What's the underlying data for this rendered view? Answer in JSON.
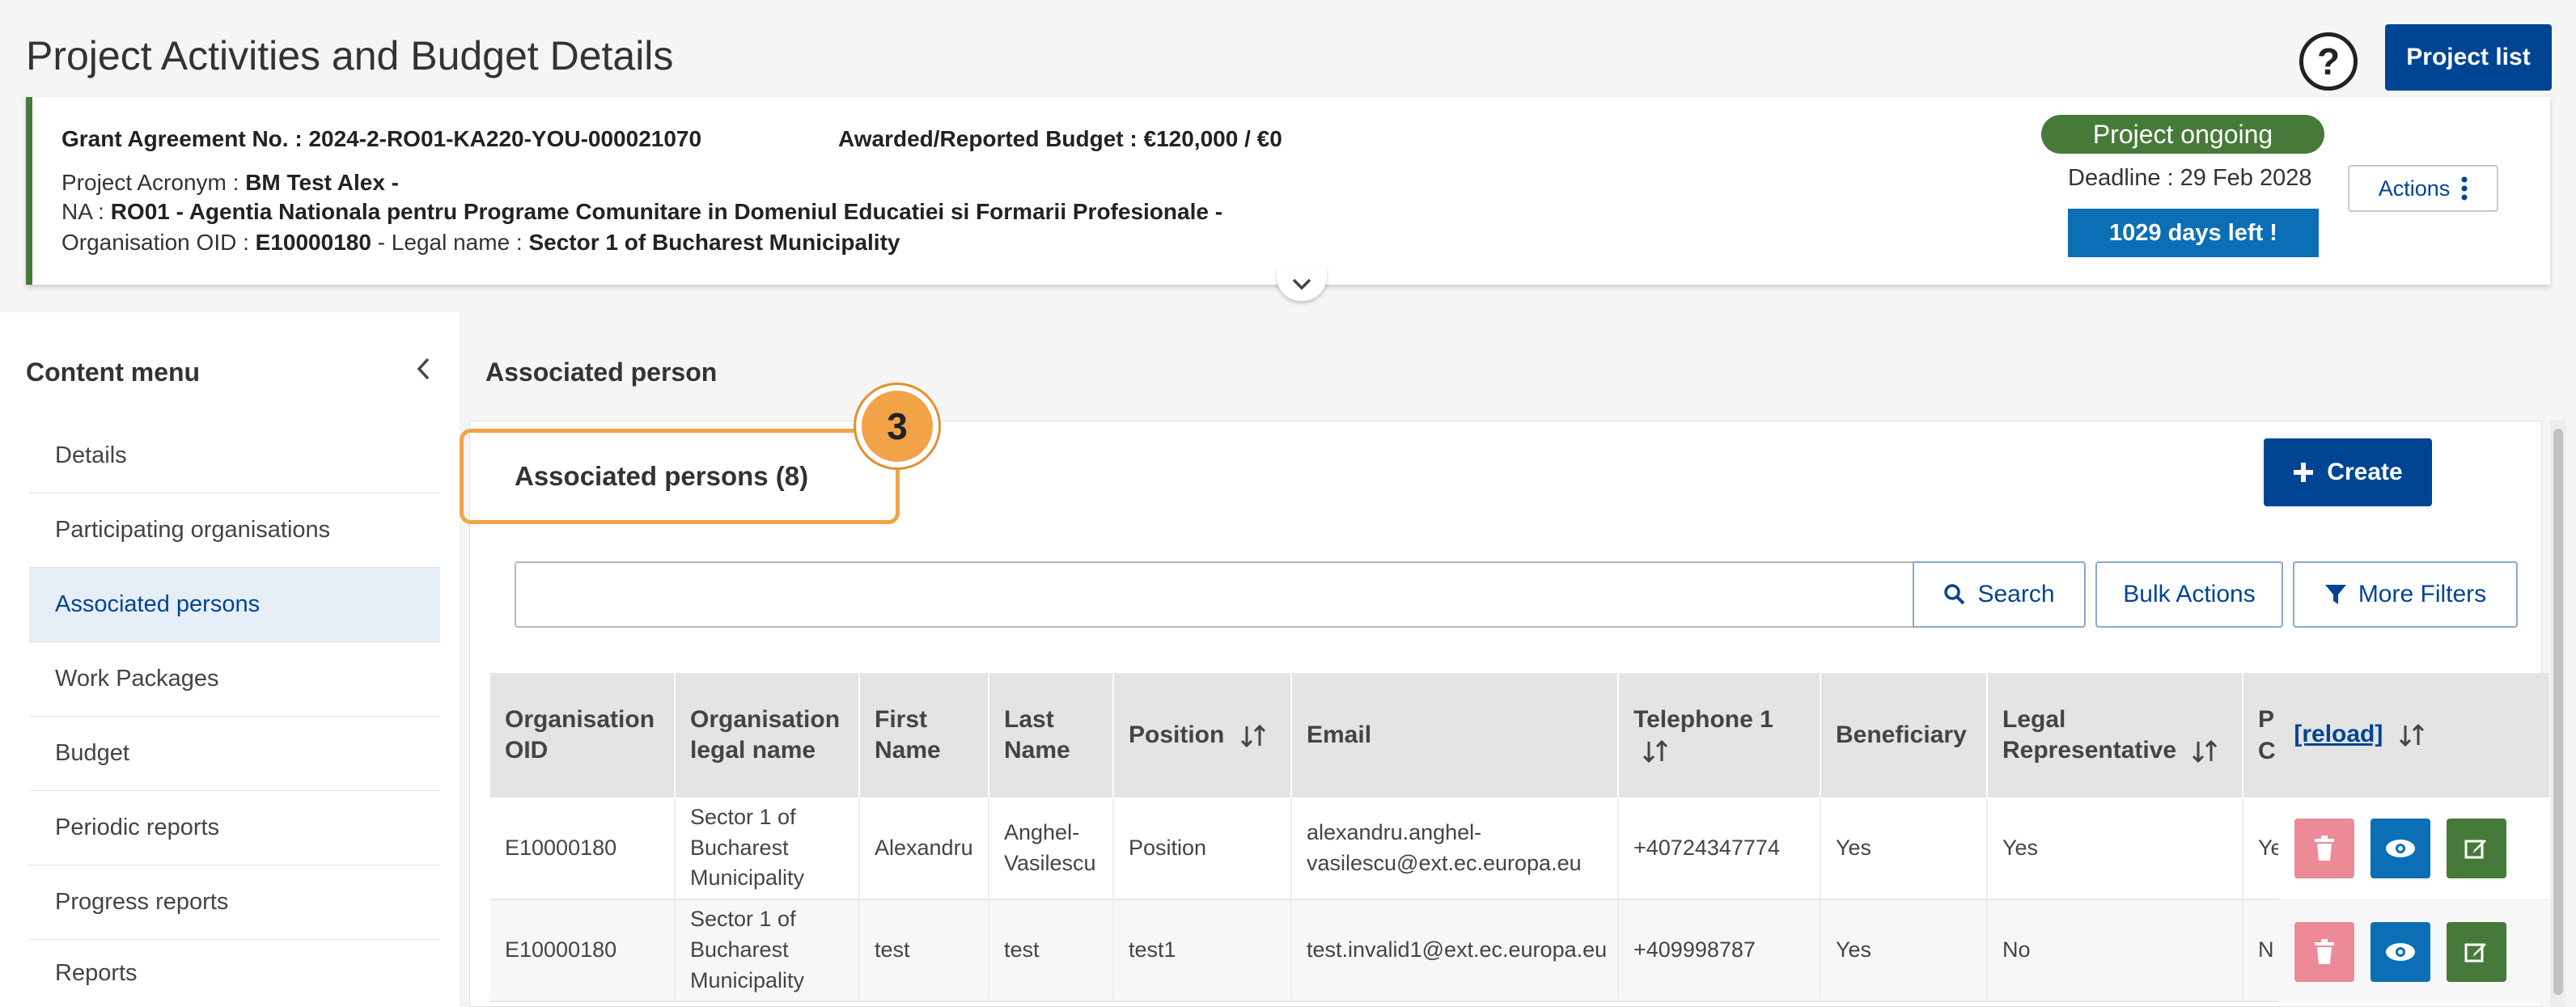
{
  "header": {
    "title": "Project Activities and Budget Details",
    "help_label": "?",
    "project_list_label": "Project list"
  },
  "project": {
    "grant_label": "Grant Agreement No. : ",
    "grant_value": "2024-2-RO01-KA220-YOU-000021070",
    "budget_label": "Awarded/Reported Budget : ",
    "budget_value": "€120,000 / €0",
    "acronym_label": "Project Acronym : ",
    "acronym_value": "BM Test Alex -",
    "na_label": "NA : ",
    "na_value": "RO01 - Agentia Nationala pentru Programe Comunitare in Domeniul Educatiei si Formarii Profesionale -",
    "oid_label": "Organisation OID : ",
    "oid_value": "E10000180",
    "legal_label": " - Legal name : ",
    "legal_value": "Sector 1 of Bucharest Municipality",
    "status": "Project ongoing",
    "deadline": "Deadline : 29 Feb 2028",
    "days_left": "1029 days left !",
    "actions_label": "Actions"
  },
  "sidebar": {
    "title": "Content menu",
    "items": [
      {
        "label": "Details"
      },
      {
        "label": "Participating organisations"
      },
      {
        "label": "Associated persons"
      },
      {
        "label": "Work Packages"
      },
      {
        "label": "Budget"
      },
      {
        "label": "Periodic reports"
      },
      {
        "label": "Progress reports"
      },
      {
        "label": "Reports"
      }
    ]
  },
  "main": {
    "heading": "Associated person",
    "panel_title": "Associated persons (8)",
    "step_number": "3",
    "create_label": "Create",
    "search_label": "Search",
    "bulk_label": "Bulk Actions",
    "filters_label": "More Filters"
  },
  "table": {
    "columns": [
      "Organisation OID",
      "Organisation legal name",
      "First Name",
      "Last Name",
      "Position",
      "Email",
      "Telephone 1",
      "Beneficiary",
      "Legal Representative",
      "P C"
    ],
    "reload_label": "[reload]",
    "rows": [
      [
        "E10000180",
        "Sector 1 of Bucharest Municipality",
        "Alexandru",
        "Anghel-Vasilescu",
        "Position",
        "alexandru.anghel-vasilescu@ext.ec.europa.eu",
        "+40724347774",
        "Yes",
        "Yes",
        "Ye"
      ],
      [
        "E10000180",
        "Sector 1 of Bucharest Municipality",
        "test",
        "test",
        "test1",
        "test.invalid1@ext.ec.europa.eu",
        "+409998787",
        "Yes",
        "No",
        "N"
      ]
    ]
  },
  "colors": {
    "primary": "#004494",
    "success": "#467a39",
    "info": "#0a6fb5",
    "danger_light": "#ec8b97",
    "highlight": "#f2a348"
  }
}
